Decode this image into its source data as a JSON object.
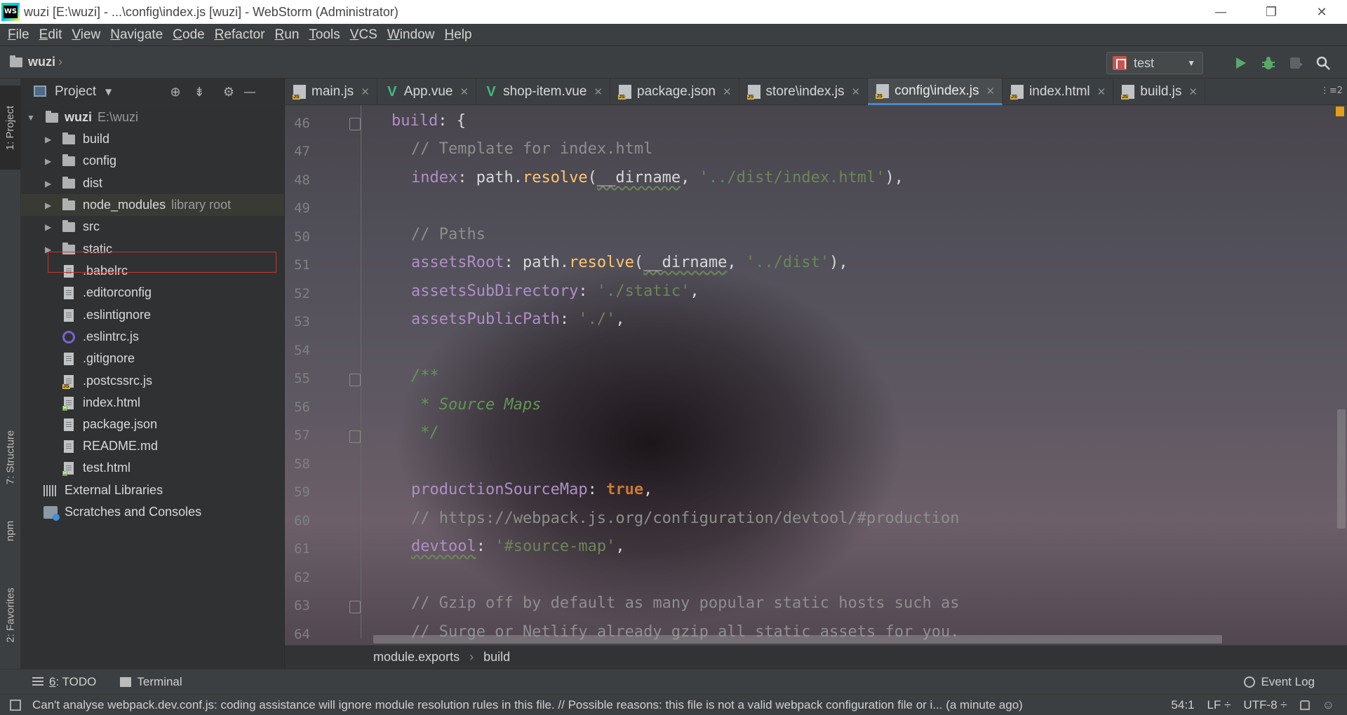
{
  "window": {
    "title": "wuzi [E:\\wuzi] - ...\\config\\index.js [wuzi] - WebStorm (Administrator)",
    "minimize": "—",
    "restore": "❐",
    "close": "✕"
  },
  "menu": [
    {
      "u": "F",
      "rest": "ile"
    },
    {
      "u": "E",
      "rest": "dit"
    },
    {
      "u": "V",
      "rest": "iew"
    },
    {
      "u": "N",
      "rest": "avigate"
    },
    {
      "u": "C",
      "rest": "ode"
    },
    {
      "u": "R",
      "rest": "efactor"
    },
    {
      "u": "R",
      "rest": "un"
    },
    {
      "u": "T",
      "rest": "ools"
    },
    {
      "u": "V",
      "rest": "CS"
    },
    {
      "u": "W",
      "rest": "indow"
    },
    {
      "u": "H",
      "rest": "elp"
    }
  ],
  "navbar": {
    "project": "wuzi",
    "run_config": "test"
  },
  "left_strip": {
    "project": "1: Project",
    "structure": "7: Structure",
    "npm": "npm",
    "favorites": "2: Favorites"
  },
  "project_panel": {
    "title": "Project",
    "root": "wuzi",
    "root_path": "E:\\wuzi",
    "folders": [
      "build",
      "config",
      "dist",
      "node_modules",
      "src",
      "static"
    ],
    "node_modules_hint": "library root",
    "files": [
      ".babelrc",
      ".editorconfig",
      ".eslintignore",
      ".eslintrc.js",
      ".gitignore",
      ".postcssrc.js",
      "index.html",
      "package.json",
      "README.md",
      "test.html"
    ],
    "external_libraries": "External Libraries",
    "scratches": "Scratches and Consoles"
  },
  "tabs": [
    "main.js",
    "App.vue",
    "shop-item.vue",
    "package.json",
    "store\\index.js",
    "config\\index.js",
    "index.html",
    "build.js"
  ],
  "active_tab": "config\\index.js",
  "tab_overflow": "⋮≡2",
  "editor": {
    "line_numbers": [
      "46",
      "47",
      "48",
      "49",
      "50",
      "51",
      "52",
      "53",
      "54",
      "55",
      "56",
      "57",
      "58",
      "59",
      "60",
      "61",
      "62",
      "63",
      "64"
    ],
    "code": {
      "l46_key": "build",
      "l46_rest": ": {",
      "l47": "// Template for index.html",
      "l48_key": "index",
      "l48_a": ": path.",
      "l48_fn": "resolve",
      "l48_b": "(",
      "l48_dir": "__dirname",
      "l48_c": ", ",
      "l48_str": "'../dist/index.html'",
      "l48_d": "),",
      "l50": "// Paths",
      "l51_key": "assetsRoot",
      "l51_a": ": path.",
      "l51_fn": "resolve",
      "l51_b": "(",
      "l51_dir": "__dirname",
      "l51_c": ", ",
      "l51_str": "'../dist'",
      "l51_d": "),",
      "l52_key": "assetsSubDirectory",
      "l52_a": ": ",
      "l52_str": "'./static'",
      "l52_b": ",",
      "l53_key": "assetsPublicPath",
      "l53_a": ": ",
      "l53_str": "'./'",
      "l53_b": ",",
      "l55": "/**",
      "l56": " * Source Maps",
      "l57": " */",
      "l59_key": "productionSourceMap",
      "l59_a": ": ",
      "l59_kw": "true",
      "l59_b": ",",
      "l60": "// https://webpack.js.org/configuration/devtool/#production",
      "l61_key": "devtool",
      "l61_a": ": ",
      "l61_str": "'#source-map'",
      "l61_b": ",",
      "l63": "// Gzip off by default as many popular static hosts such as",
      "l64": "// Surge or Netlify already gzip all static assets for you."
    },
    "breadcrumb": [
      "module.exports",
      "build"
    ]
  },
  "bottom_tools": {
    "todo_num": "6",
    "todo_rest": ": TODO",
    "terminal": "Terminal",
    "event_log": "Event Log"
  },
  "status": {
    "message": "Can't analyse webpack.dev.conf.js: coding assistance will ignore module resolution rules in this file. // Possible reasons: this file is not a valid webpack configuration file or i... (a minute ago)",
    "position": "54:1",
    "line_sep": "LF ÷",
    "encoding": "UTF-8 ÷"
  }
}
